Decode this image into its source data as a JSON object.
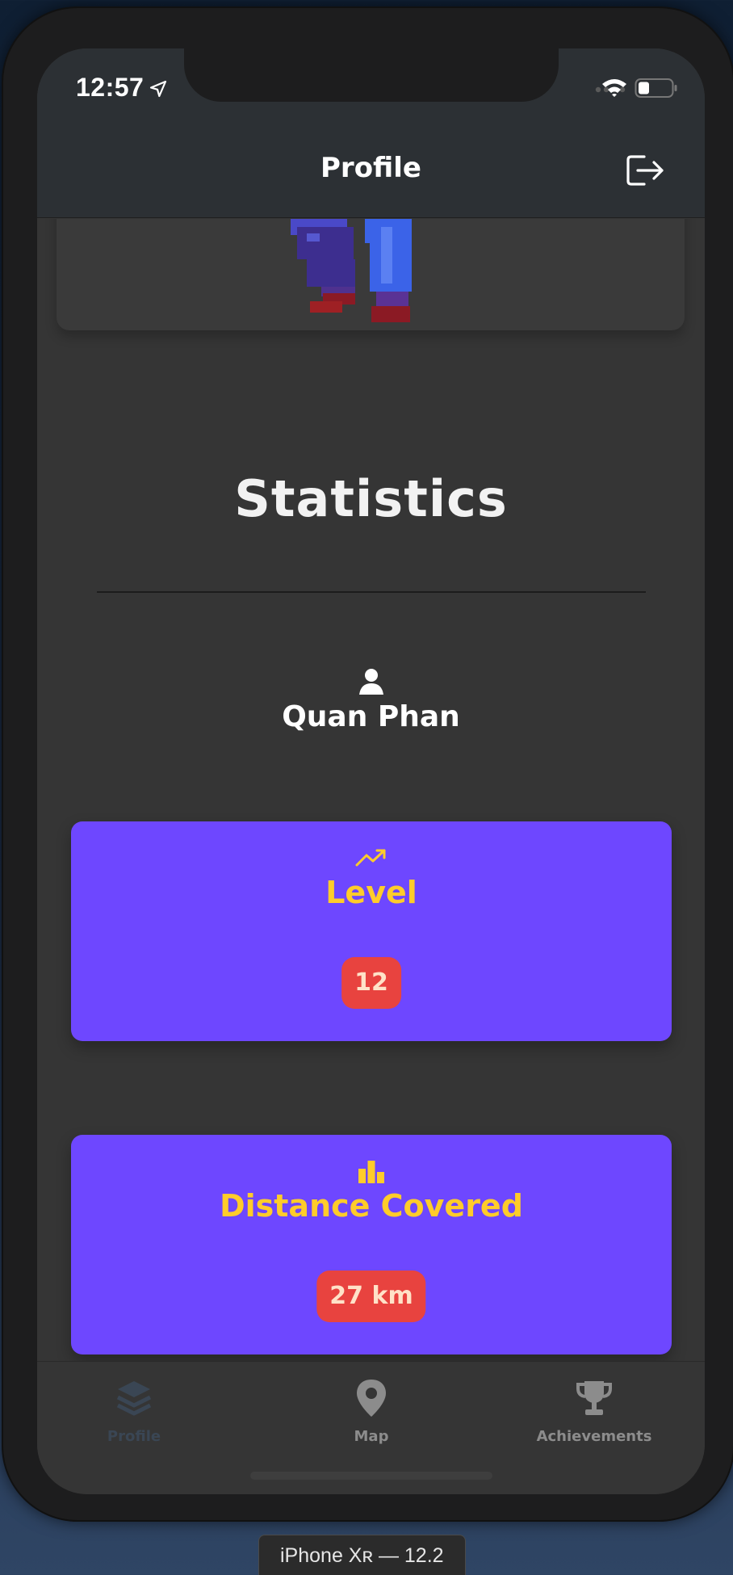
{
  "status_bar": {
    "time": "12:57",
    "icons": [
      "location-arrow-icon",
      "cellular-signal-icon",
      "wifi-icon",
      "battery-icon"
    ]
  },
  "nav": {
    "title": "Profile",
    "logout_icon": "logout-icon"
  },
  "statistics": {
    "title": "Statistics",
    "user_name": "Quan Phan",
    "user_icon": "user-icon",
    "cards": [
      {
        "icon": "trending-up-icon",
        "label": "Level",
        "value": "12"
      },
      {
        "icon": "bar-chart-icon",
        "label": "Distance Covered",
        "value": "27 km"
      }
    ]
  },
  "tabs": [
    {
      "label": "Profile",
      "icon": "layers-icon",
      "active": true
    },
    {
      "label": "Map",
      "icon": "map-pin-icon",
      "active": false
    },
    {
      "label": "Achievements",
      "icon": "trophy-icon",
      "active": false
    }
  ],
  "simulator_label": "iPhone Xʀ — 12.2",
  "colors": {
    "background": "#353535",
    "card": "#6e47ff",
    "accent_yellow": "#ffcc2a",
    "badge_red": "#e8433f",
    "header": "#2c3034"
  }
}
